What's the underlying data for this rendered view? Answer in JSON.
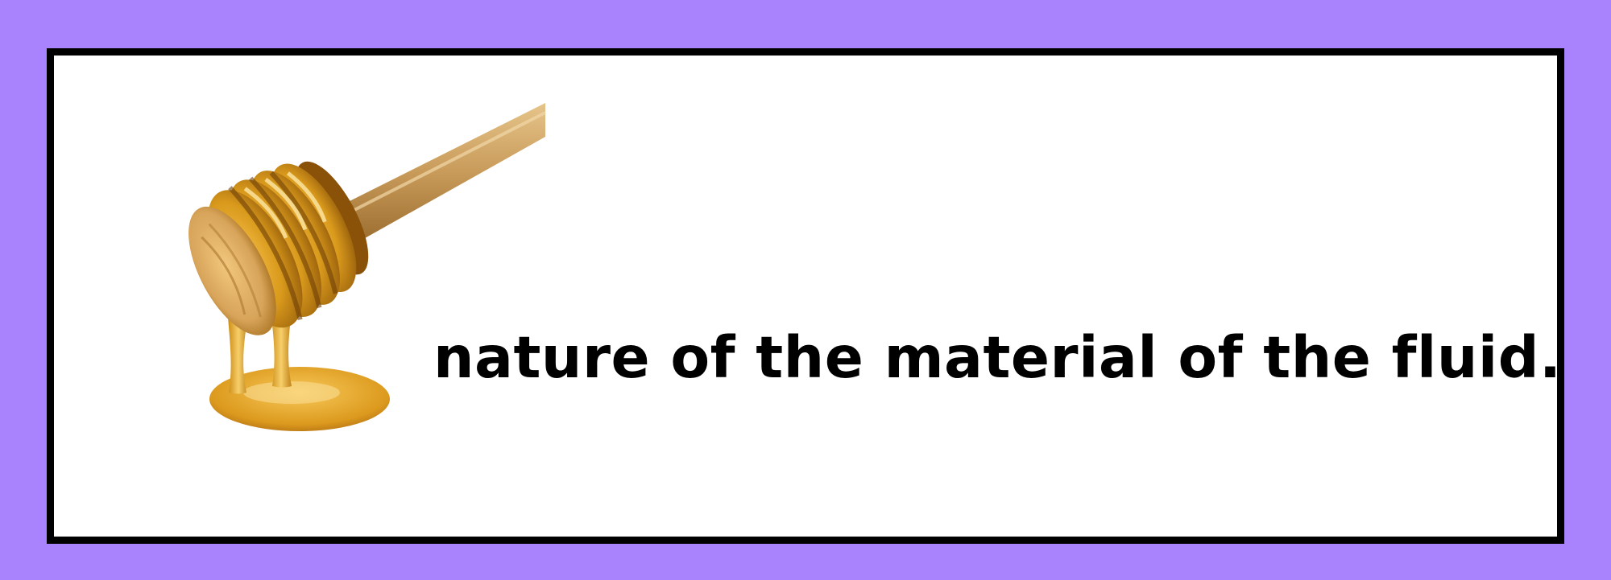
{
  "caption": "nature of the material of the fluid.",
  "colors": {
    "background": "#a883fd",
    "card": "#ffffff",
    "border": "#000000",
    "text": "#000000",
    "honey": "#d99a1c",
    "wood": "#c89b5a"
  },
  "illustration": {
    "icon": "honey-dipper-icon"
  }
}
